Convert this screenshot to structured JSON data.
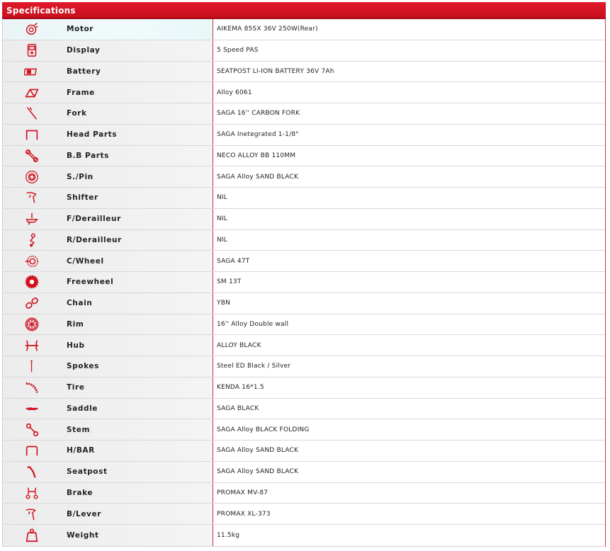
{
  "header": {
    "title": "Specifications"
  },
  "accent_color": "#d0121f",
  "rows": [
    {
      "icon": "motor-icon",
      "label": "Motor",
      "value": "AIKEMA 85SX 36V 250W(Rear)"
    },
    {
      "icon": "display-icon",
      "label": "Display",
      "value": "5 Speed PAS"
    },
    {
      "icon": "battery-icon",
      "label": "Battery",
      "value": "SEATPOST LI-ION BATTERY 36V 7Ah"
    },
    {
      "icon": "frame-icon",
      "label": "Frame",
      "value": "Alloy 6061"
    },
    {
      "icon": "fork-icon",
      "label": "Fork",
      "value": "SAGA 16'' CARBON FORK"
    },
    {
      "icon": "head-parts-icon",
      "label": "Head Parts",
      "value": "SAGA Inetegrated 1-1/8\""
    },
    {
      "icon": "bb-parts-icon",
      "label": "B.B Parts",
      "value": "NECO ALLOY BB 110MM"
    },
    {
      "icon": "pedal-icon",
      "label": "S./Pin",
      "value": "SAGA Alloy SAND BLACK"
    },
    {
      "icon": "shifter-icon",
      "label": "Shifter",
      "value": "NIL"
    },
    {
      "icon": "front-derailleur-icon",
      "label": "F/Derailleur",
      "value": "NIL"
    },
    {
      "icon": "rear-derailleur-icon",
      "label": "R/Derailleur",
      "value": "NIL"
    },
    {
      "icon": "chainwheel-icon",
      "label": "C/Wheel",
      "value": "SAGA 47T"
    },
    {
      "icon": "freewheel-icon",
      "label": "Freewheel",
      "value": "SM 13T"
    },
    {
      "icon": "chain-icon",
      "label": "Chain",
      "value": "YBN"
    },
    {
      "icon": "rim-icon",
      "label": "Rim",
      "value": "16'' Alloy Double wall"
    },
    {
      "icon": "hub-icon",
      "label": "Hub",
      "value": "ALLOY BLACK"
    },
    {
      "icon": "spokes-icon",
      "label": "Spokes",
      "value": "Steel ED Black / Silver"
    },
    {
      "icon": "tire-icon",
      "label": "Tire",
      "value": "KENDA 16*1.5"
    },
    {
      "icon": "saddle-icon",
      "label": "Saddle",
      "value": "SAGA BLACK"
    },
    {
      "icon": "stem-icon",
      "label": "Stem",
      "value": "SAGA Alloy BLACK FOLDING"
    },
    {
      "icon": "handlebar-icon",
      "label": "H/BAR",
      "value": "SAGA Alloy SAND BLACK"
    },
    {
      "icon": "seatpost-icon",
      "label": "Seatpost",
      "value": "SAGA Alloy SAND BLACK"
    },
    {
      "icon": "brake-icon",
      "label": "Brake",
      "value": "PROMAX MV-87"
    },
    {
      "icon": "brake-lever-icon",
      "label": "B/Lever",
      "value": "PROMAX XL-373"
    },
    {
      "icon": "weight-icon",
      "label": "Weight",
      "value": "11.5kg"
    }
  ]
}
